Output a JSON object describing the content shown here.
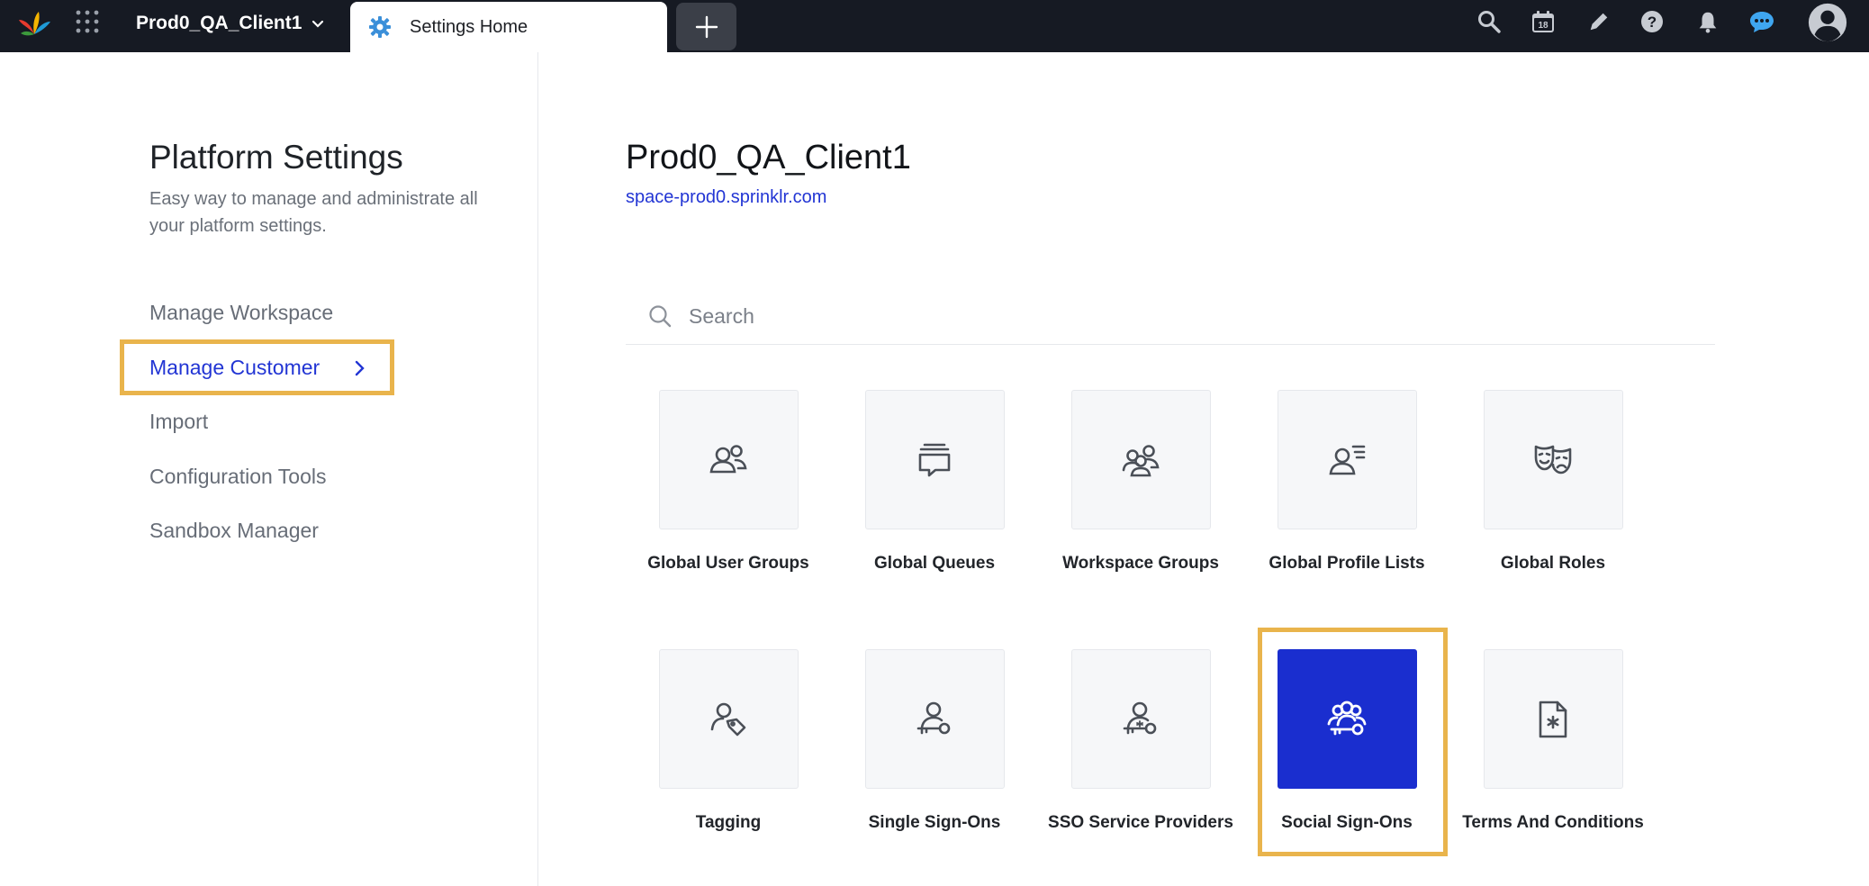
{
  "topbar": {
    "client_name": "Prod0_QA_Client1",
    "active_tab": "Settings Home",
    "icons": [
      "search-icon",
      "calendar-icon",
      "edit-icon",
      "help-icon",
      "bell-icon",
      "chat-icon",
      "profile-avatar"
    ],
    "calendar_day": "18",
    "colors": {
      "bar": "#161a23",
      "chat": "#3fa6f0"
    }
  },
  "sidebar": {
    "title": "Platform Settings",
    "subtitle": "Easy way to manage and administrate all your platform settings.",
    "items": [
      {
        "label": "Manage Workspace",
        "active": false
      },
      {
        "label": "Manage Customer",
        "active": true
      },
      {
        "label": "Import",
        "active": false
      },
      {
        "label": "Configuration Tools",
        "active": false
      },
      {
        "label": "Sandbox Manager",
        "active": false
      }
    ]
  },
  "main": {
    "client_title": "Prod0_QA_Client1",
    "client_url": "space-prod0.sprinklr.com",
    "search": {
      "placeholder": "Search",
      "value": ""
    },
    "cards": [
      {
        "label": "Global User Groups",
        "icon": "user-group-icon"
      },
      {
        "label": "Global Queues",
        "icon": "queues-icon"
      },
      {
        "label": "Workspace Groups",
        "icon": "workspace-groups-icon"
      },
      {
        "label": "Global Profile Lists",
        "icon": "profile-list-icon"
      },
      {
        "label": "Global Roles",
        "icon": "theater-masks-icon"
      },
      {
        "label": "Tagging",
        "icon": "user-tag-icon"
      },
      {
        "label": "Single Sign-Ons",
        "icon": "user-key-icon"
      },
      {
        "label": "SSO Service Providers",
        "icon": "user-key-star-icon"
      },
      {
        "label": "Social Sign-Ons",
        "icon": "group-key-icon",
        "selected": true
      },
      {
        "label": "Terms And Conditions",
        "icon": "document-asterisk-icon"
      }
    ],
    "colors": {
      "accent": "#1a2ecf",
      "link": "#2235d4",
      "highlight": "#e9b44c"
    }
  }
}
